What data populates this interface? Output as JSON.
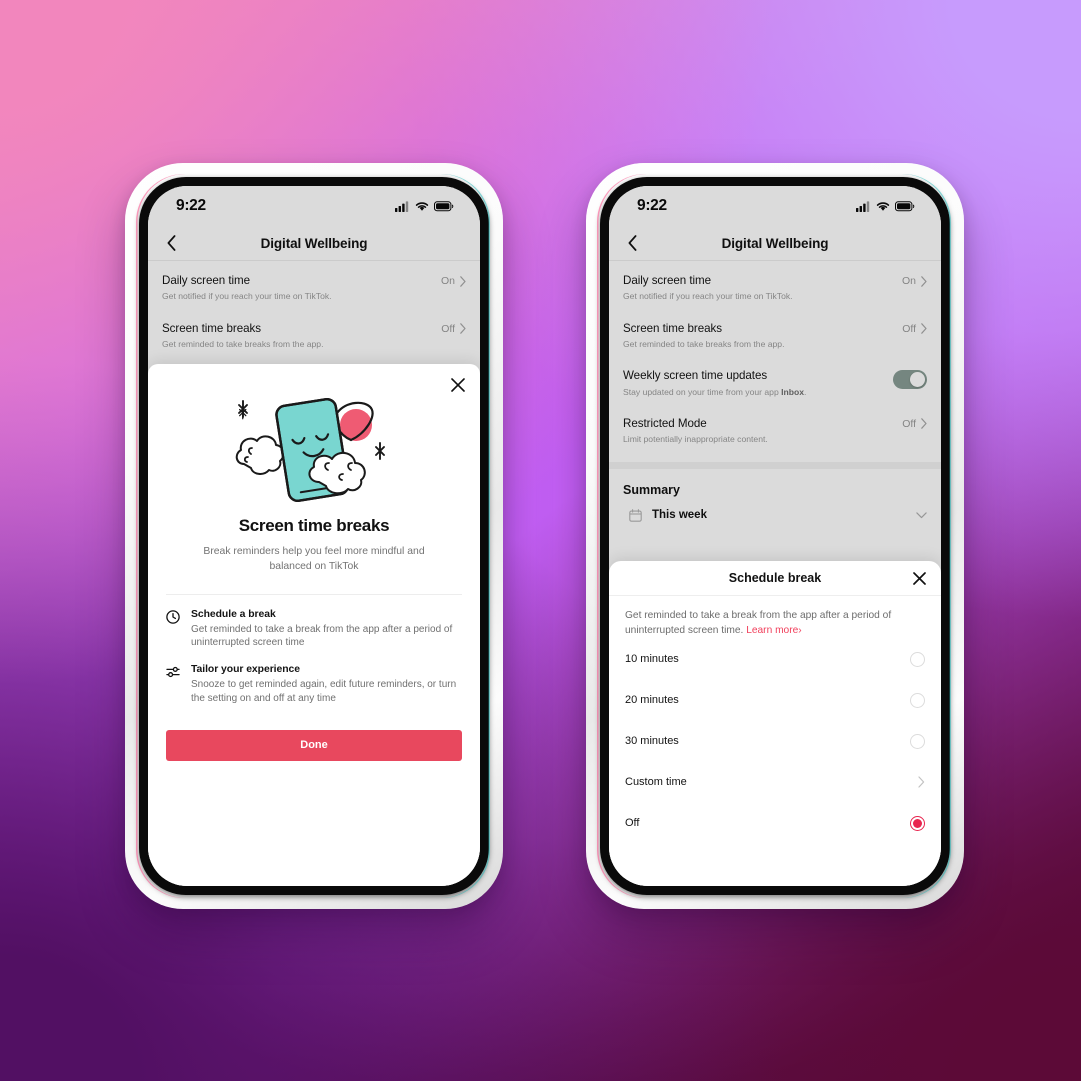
{
  "background": {
    "gradient_colors": [
      "#f286bd",
      "#c79bfd",
      "#c460f6",
      "#521063",
      "#5c0a37"
    ]
  },
  "theme": {
    "accent_red": "#e8485e",
    "link_red": "#f1405c",
    "selected_red": "#e8254f",
    "toggle_green": "#18c07e",
    "illustration_teal": "#79d6d0",
    "illustration_pink": "#ef5b73"
  },
  "phones": [
    {
      "id": "left",
      "status_bar": {
        "time": "9:22",
        "icons": [
          "cellular-signal-icon",
          "wifi-icon",
          "battery-icon"
        ]
      },
      "nav": {
        "back_icon": "chevron-left-icon",
        "title": "Digital Wellbeing"
      },
      "settings_rows": [
        {
          "label": "Daily screen time",
          "sub": "Get notified if you reach your time on TikTok.",
          "value": "On",
          "control": "chevron"
        },
        {
          "label": "Screen time breaks",
          "sub": "Get reminded to take breaks from the app.",
          "value": "Off",
          "control": "chevron"
        }
      ],
      "sheet": {
        "type": "onboarding",
        "close_icon": "close-icon",
        "illustration": "sleeping-phone-clouds-planet-illustration",
        "title": "Screen time breaks",
        "subtitle": "Break reminders help you feel more mindful and balanced on TikTok",
        "features": [
          {
            "icon": "clock-icon",
            "title": "Schedule a break",
            "desc": "Get reminded to take a break from the app after a period of uninterrupted screen time"
          },
          {
            "icon": "sliders-icon",
            "title": "Tailor your experience",
            "desc": "Snooze to get reminded again, edit future reminders, or turn the setting on and off at any time"
          }
        ],
        "primary_button": "Done"
      }
    },
    {
      "id": "right",
      "status_bar": {
        "time": "9:22",
        "icons": [
          "cellular-signal-icon",
          "wifi-icon",
          "battery-icon"
        ]
      },
      "nav": {
        "back_icon": "chevron-left-icon",
        "title": "Digital Wellbeing"
      },
      "settings_rows": [
        {
          "label": "Daily screen time",
          "sub": "Get notified if you reach your time on TikTok.",
          "value": "On",
          "control": "chevron"
        },
        {
          "label": "Screen time breaks",
          "sub": "Get reminded to take breaks from the app.",
          "value": "Off",
          "control": "chevron"
        },
        {
          "label": "Weekly screen time updates",
          "sub_pre": "Stay updated on your time from your app ",
          "sub_bold": "Inbox",
          "sub_post": ".",
          "value": "",
          "control": "toggle",
          "toggle_on": true
        },
        {
          "label": "Restricted Mode",
          "sub": "Limit potentially inappropriate content.",
          "value": "Off",
          "control": "chevron"
        }
      ],
      "summary": {
        "section_title": "Summary",
        "row_icon": "calendar-icon",
        "row_label": "This week",
        "chevron_icon": "chevron-down-icon"
      },
      "sheet": {
        "type": "schedule-break",
        "title": "Schedule break",
        "close_icon": "close-icon",
        "description_pre": "Get reminded to take a break from the app after a period of uninterrupted screen time. ",
        "learn_more": "Learn more",
        "learn_more_chevron": "›",
        "options": [
          {
            "label": "10 minutes",
            "control": "radio",
            "selected": false
          },
          {
            "label": "20 minutes",
            "control": "radio",
            "selected": false
          },
          {
            "label": "30 minutes",
            "control": "radio",
            "selected": false
          },
          {
            "label": "Custom time",
            "control": "chevron",
            "selected": false
          },
          {
            "label": "Off",
            "control": "radio",
            "selected": true
          }
        ]
      }
    }
  ]
}
